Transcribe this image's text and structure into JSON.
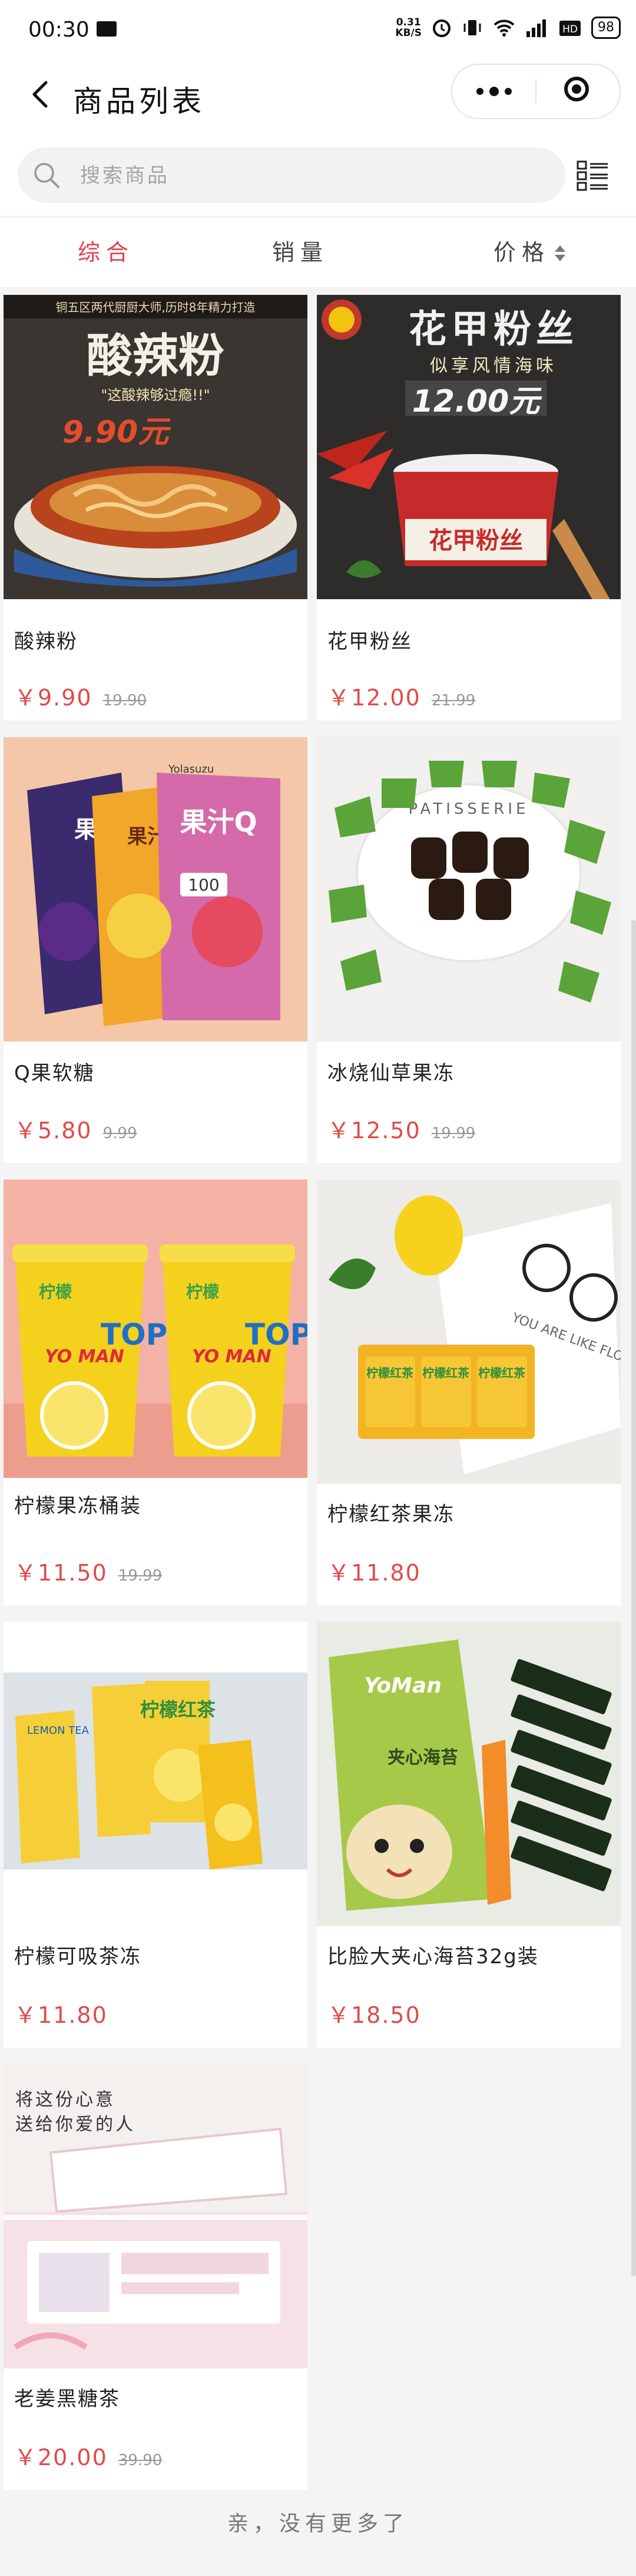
{
  "status": {
    "time": "00:30",
    "speed_top": "0.31",
    "speed_bottom": "KB/S",
    "battery": "98"
  },
  "nav": {
    "title": "商品列表"
  },
  "search": {
    "placeholder": "搜索商品"
  },
  "sort": {
    "items": [
      "综合",
      "销量",
      "价格"
    ]
  },
  "products": [
    {
      "name": "酸辣粉",
      "price": "￥9.90",
      "original": "19.90",
      "banner_title": "酸辣粉",
      "banner_sub": "\"这酸辣够过瘾!!\"",
      "banner_price": "9.90元",
      "banner_top": "铜五区两代厨厨大师,历时8年精力打造"
    },
    {
      "name": "花甲粉丝",
      "price": "￥12.00",
      "original": "21.99",
      "banner_title": "花甲粉丝",
      "banner_sub": "似享风情海味",
      "banner_price": "12.00元",
      "banner_cup": "花甲粉丝"
    },
    {
      "name": "Q果软糖",
      "price": "￥5.80",
      "original": "9.99",
      "pack1": "果汁",
      "pack2": "果汁Q",
      "pack3": "100",
      "brand": "Yolasuzu"
    },
    {
      "name": "冰烧仙草果冻",
      "price": "￥12.50",
      "original": "19.99",
      "plate_text": "PATISSERIE"
    },
    {
      "name": "柠檬果冻桶装",
      "price": "￥11.50",
      "original": "19.99",
      "tub_brand": "YO MAN",
      "tub_top": "TOP",
      "tub_cn": "柠檬"
    },
    {
      "name": "柠檬红茶果冻",
      "price": "￥11.80",
      "original": "",
      "box_cn": "柠檬红茶",
      "paper_text": "YOU ARE LIKE FLOWER"
    },
    {
      "name": "柠檬可吸茶冻",
      "price": "￥11.80",
      "original": "",
      "pouch_cn": "柠檬红茶",
      "pouch_en": "LEMON TEA"
    },
    {
      "name": "比脸大夹心海苔32g装",
      "price": "￥18.50",
      "original": "",
      "bag_brand": "YoMan",
      "bag_cn": "夹心海苔"
    },
    {
      "name": "老姜黑糖茶",
      "price": "￥20.00",
      "original": "39.90",
      "slogan1": "将这份心意",
      "slogan2": "送给你爱的人"
    }
  ],
  "footer": {
    "end_text": "亲，没有更多了"
  }
}
